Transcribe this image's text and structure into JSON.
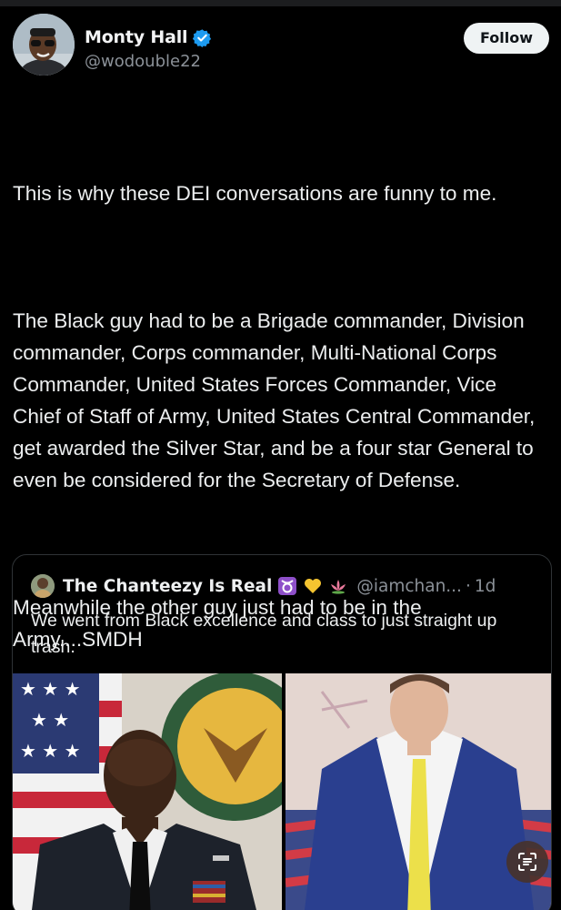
{
  "post": {
    "author": {
      "display_name": "Monty Hall",
      "handle": "@wodouble22",
      "verified": true,
      "avatar_icon": "profile-photo-man-sunglasses"
    },
    "follow_label": "Follow",
    "paragraphs": [
      "This is why these DEI conversations are funny to me.",
      "The Black guy had to be a Brigade commander, Division commander, Corps commander, Multi-National Corps Commander, United States Forces Commander, Vice Chief of Staff of Army, United States Central Commander, get awarded the Silver Star, and be a four star General to even be considered for the Secretary of Defense.",
      "Meanwhile the other guy just had to be in the Army....SMDH"
    ]
  },
  "quoted_post": {
    "display_name": "The Chanteezy Is Real",
    "name_emojis": [
      "taurus-icon",
      "yellow-heart-icon",
      "lotus-icon"
    ],
    "handle": "@iamchan...",
    "separator": "·",
    "time": "1d",
    "text": "We went from Black excellence and class to just straight up trash.",
    "media": [
      {
        "icon": "photo-general-in-uniform-with-flag"
      },
      {
        "icon": "photo-man-in-suit-with-american-flag"
      }
    ]
  },
  "overlay": {
    "scan_icon": "text-scan-icon"
  },
  "colors": {
    "background": "#000000",
    "text": "#e7e9ea",
    "muted": "#8b9198",
    "verified_blue": "#1d9bf0",
    "border": "#2f3336"
  }
}
